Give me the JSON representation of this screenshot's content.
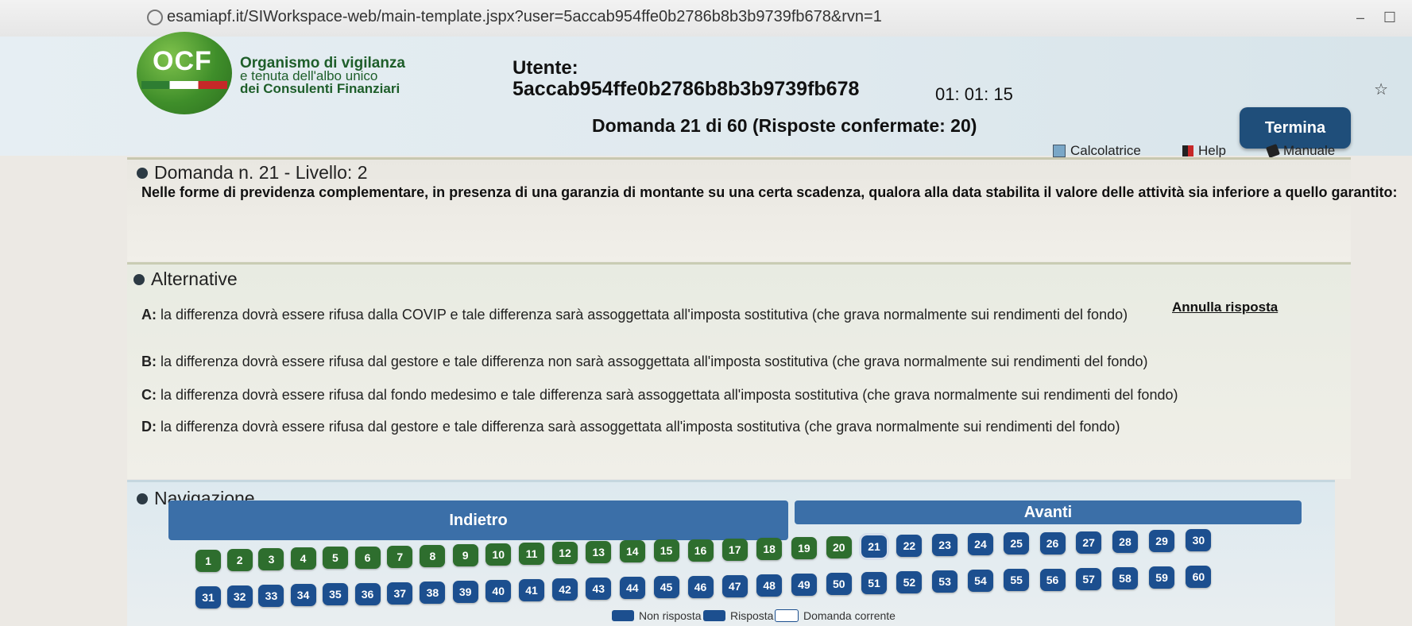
{
  "browser": {
    "url": "esamiapf.it/SIWorkspace-web/main-template.jspx?user=5accab954ffe0b2786b8b3b9739fb678&rvn=1"
  },
  "header": {
    "logo_text": "OCF",
    "org_line1": "Organismo di vigilanza",
    "org_line2": "e tenuta dell'albo unico",
    "org_line3": "dei Consulenti Finanziari",
    "utente_label": "Utente:",
    "utente_value": "5accab954ffe0b2786b8b3b9739fb678",
    "timer": "01: 01: 15",
    "domanda_title": "Domanda 21 di 60 (Risposte confermate: 20)",
    "termina_label": "Termina",
    "tools": {
      "calcolatrice": "Calcolatrice",
      "help": "Help",
      "manuale": "Manuale"
    }
  },
  "question": {
    "heading": "Domanda n. 21 - Livello: 2",
    "text": "Nelle forme di previdenza complementare, in presenza di una garanzia di montante su una certa scadenza, qualora alla data stabilita il valore delle attività sia inferiore a quello garantito:"
  },
  "alternatives": {
    "heading": "Alternative",
    "annulla": "Annulla risposta",
    "items": [
      {
        "letter": "A:",
        "text": " la differenza dovrà essere rifusa dalla COVIP e tale differenza sarà assoggettata all'imposta sostitutiva (che grava normalmente sui rendimenti del fondo)"
      },
      {
        "letter": "B:",
        "text": " la differenza dovrà essere rifusa dal gestore e tale differenza non sarà assoggettata all'imposta sostitutiva (che grava normalmente sui rendimenti del fondo)"
      },
      {
        "letter": "C:",
        "text": " la differenza dovrà essere rifusa dal fondo medesimo e tale differenza sarà assoggettata all'imposta sostitutiva (che grava normalmente sui rendimenti del fondo)"
      },
      {
        "letter": "D:",
        "text": " la differenza dovrà essere rifusa dal gestore e tale differenza sarà assoggettata all'imposta sostitutiva (che grava normalmente sui rendimenti del fondo)"
      }
    ]
  },
  "navigation": {
    "heading": "Navigazione",
    "indietro": "Indietro",
    "avanti": "Avanti",
    "questions": [
      "1",
      "2",
      "3",
      "4",
      "5",
      "6",
      "7",
      "8",
      "9",
      "10",
      "11",
      "12",
      "13",
      "14",
      "15",
      "16",
      "17",
      "18",
      "19",
      "20",
      "21",
      "22",
      "23",
      "24",
      "25",
      "26",
      "27",
      "28",
      "29",
      "30",
      "31",
      "32",
      "33",
      "34",
      "35",
      "36",
      "37",
      "38",
      "39",
      "40",
      "41",
      "42",
      "43",
      "44",
      "45",
      "46",
      "47",
      "48",
      "49",
      "50",
      "51",
      "52",
      "53",
      "54",
      "55",
      "56",
      "57",
      "58",
      "59",
      "60"
    ],
    "answered_through": 20,
    "current": 21,
    "legend": {
      "non_risposta": "Non risposta",
      "risposta": "Risposta",
      "corrente": "Domanda corrente"
    }
  },
  "colors": {
    "not_answered": "#1c4f8f",
    "answered": "#2e6e2e",
    "nav_button": "#3b6fa8",
    "termina": "#1f4e7a"
  }
}
